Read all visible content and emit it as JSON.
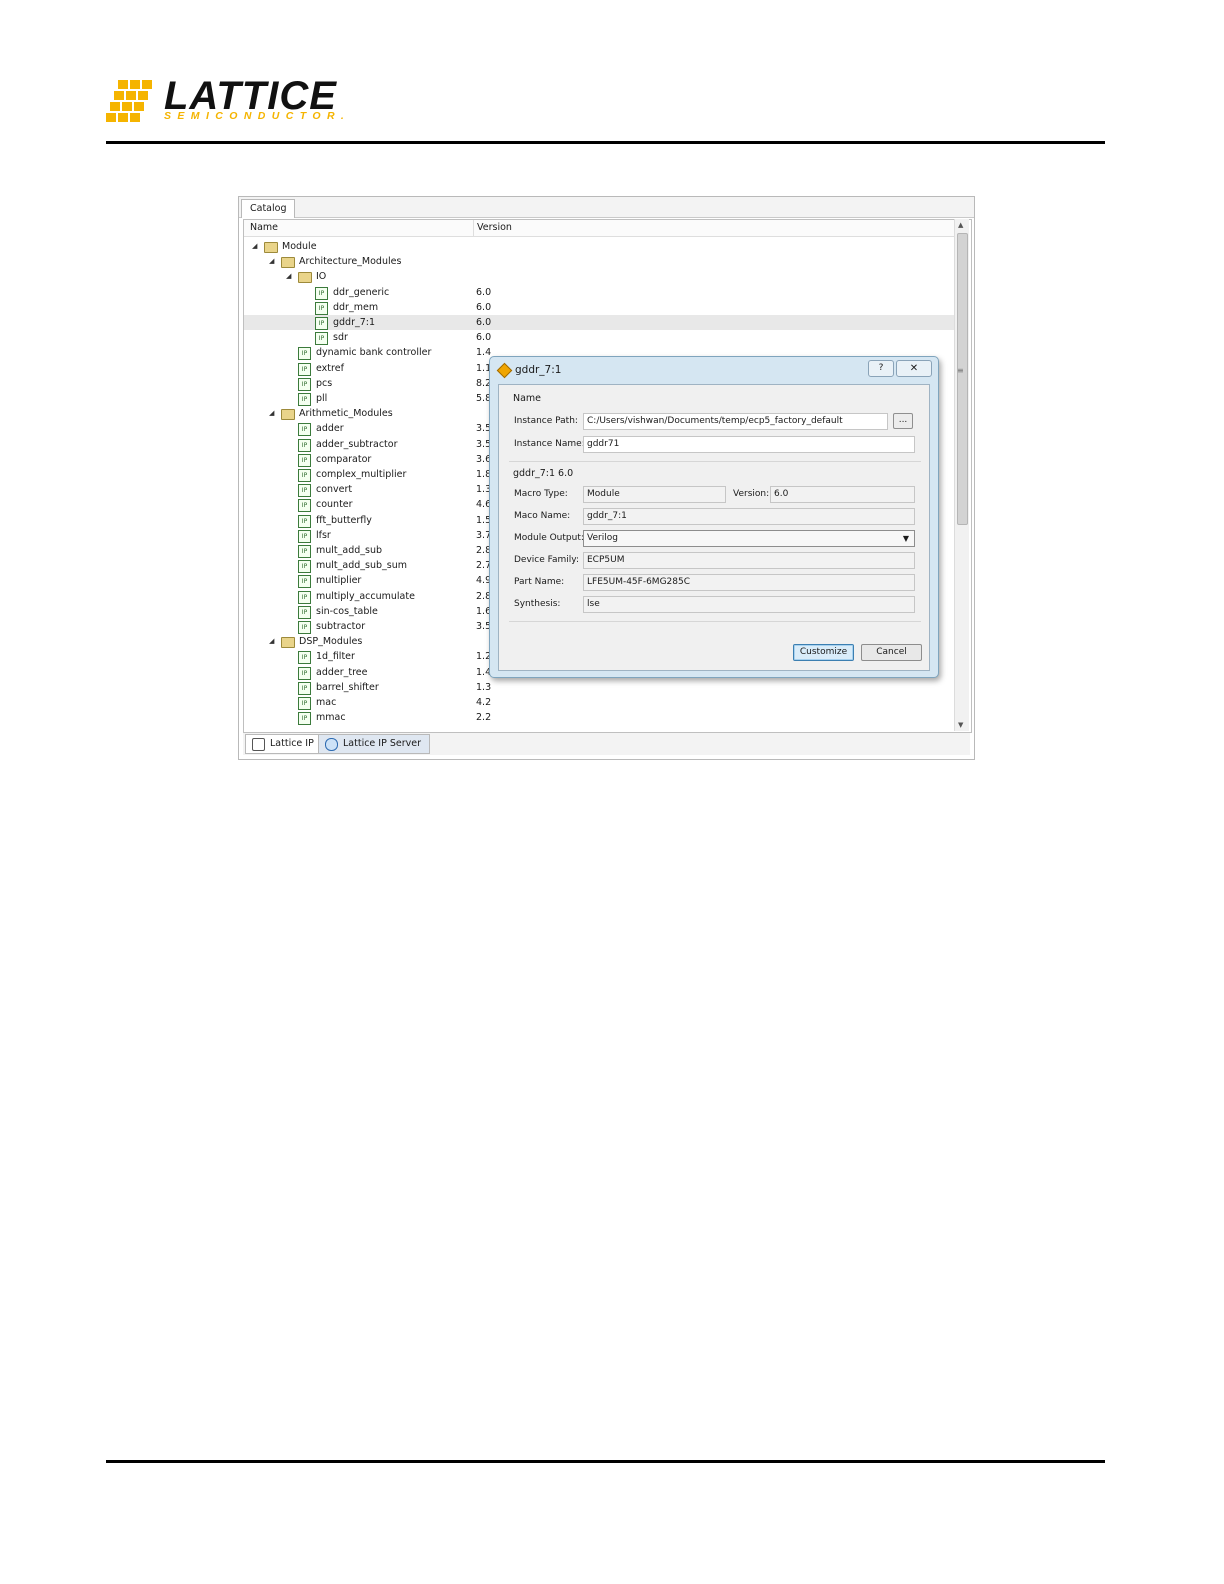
{
  "logo": {
    "wordmark": "LATTICE",
    "tagline": "SEMICONDUCTOR."
  },
  "catalog": {
    "tab_label": "Catalog",
    "columns": {
      "name": "Name",
      "version": "Version"
    },
    "rows": [
      {
        "label": "Module",
        "version": "",
        "level": 0,
        "kind": "folder",
        "expanded": true
      },
      {
        "label": "Architecture_Modules",
        "version": "",
        "level": 1,
        "kind": "folder",
        "expanded": true
      },
      {
        "label": "IO",
        "version": "",
        "level": 2,
        "kind": "folder",
        "expanded": true
      },
      {
        "label": "ddr_generic",
        "version": "6.0",
        "level": 3,
        "kind": "module"
      },
      {
        "label": "ddr_mem",
        "version": "6.0",
        "level": 3,
        "kind": "module"
      },
      {
        "label": "gddr_7:1",
        "version": "6.0",
        "level": 3,
        "kind": "module",
        "selected": true
      },
      {
        "label": "sdr",
        "version": "6.0",
        "level": 3,
        "kind": "module"
      },
      {
        "label": "dynamic bank controller",
        "version": "1.4",
        "level": 2,
        "kind": "module"
      },
      {
        "label": "extref",
        "version": "1.1",
        "level": 2,
        "kind": "module"
      },
      {
        "label": "pcs",
        "version": "8.2",
        "level": 2,
        "kind": "module"
      },
      {
        "label": "pll",
        "version": "5.8",
        "level": 2,
        "kind": "module"
      },
      {
        "label": "Arithmetic_Modules",
        "version": "",
        "level": 1,
        "kind": "folder",
        "expanded": true
      },
      {
        "label": "adder",
        "version": "3.5",
        "level": 2,
        "kind": "module"
      },
      {
        "label": "adder_subtractor",
        "version": "3.5",
        "level": 2,
        "kind": "module"
      },
      {
        "label": "comparator",
        "version": "3.6",
        "level": 2,
        "kind": "module"
      },
      {
        "label": "complex_multiplier",
        "version": "1.8",
        "level": 2,
        "kind": "module"
      },
      {
        "label": "convert",
        "version": "1.3",
        "level": 2,
        "kind": "module"
      },
      {
        "label": "counter",
        "version": "4.6",
        "level": 2,
        "kind": "module"
      },
      {
        "label": "fft_butterfly",
        "version": "1.5",
        "level": 2,
        "kind": "module"
      },
      {
        "label": "lfsr",
        "version": "3.7",
        "level": 2,
        "kind": "module"
      },
      {
        "label": "mult_add_sub",
        "version": "2.8",
        "level": 2,
        "kind": "module"
      },
      {
        "label": "mult_add_sub_sum",
        "version": "2.7",
        "level": 2,
        "kind": "module"
      },
      {
        "label": "multiplier",
        "version": "4.9",
        "level": 2,
        "kind": "module"
      },
      {
        "label": "multiply_accumulate",
        "version": "2.8",
        "level": 2,
        "kind": "module"
      },
      {
        "label": "sin-cos_table",
        "version": "1.6",
        "level": 2,
        "kind": "module"
      },
      {
        "label": "subtractor",
        "version": "3.5",
        "level": 2,
        "kind": "module"
      },
      {
        "label": "DSP_Modules",
        "version": "",
        "level": 1,
        "kind": "folder",
        "expanded": true
      },
      {
        "label": "1d_filter",
        "version": "1.2",
        "level": 2,
        "kind": "module"
      },
      {
        "label": "adder_tree",
        "version": "1.4",
        "level": 2,
        "kind": "module"
      },
      {
        "label": "barrel_shifter",
        "version": "1.3",
        "level": 2,
        "kind": "module"
      },
      {
        "label": "mac",
        "version": "4.2",
        "level": 2,
        "kind": "module"
      },
      {
        "label": "mmac",
        "version": "2.2",
        "level": 2,
        "kind": "module"
      }
    ],
    "bottom_tabs": [
      "Lattice IP",
      "Lattice IP Server"
    ]
  },
  "dialog": {
    "title": "gddr_7:1",
    "help_glyph": "?",
    "close_glyph": "✕",
    "name_group": "Name",
    "instance_path_label": "Instance Path:",
    "instance_path_value": "C:/Users/vishwan/Documents/temp/ecp5_factory_default",
    "browse_label": "...",
    "instance_name_label": "Instance Name:",
    "instance_name_value": "gddr71",
    "module_group": "gddr_7:1 6.0",
    "macro_type_label": "Macro Type:",
    "macro_type_value": "Module",
    "version_label": "Version:",
    "version_value": "6.0",
    "maco_name_label": "Maco Name:",
    "maco_name_value": "gddr_7:1",
    "module_output_label": "Module Output:",
    "module_output_value": "Verilog",
    "device_family_label": "Device Family:",
    "device_family_value": "ECP5UM",
    "part_name_label": "Part Name:",
    "part_name_value": "LFE5UM-45F-6MG285C",
    "synthesis_label": "Synthesis:",
    "synthesis_value": "lse",
    "customize_label": "Customize",
    "cancel_label": "Cancel"
  }
}
